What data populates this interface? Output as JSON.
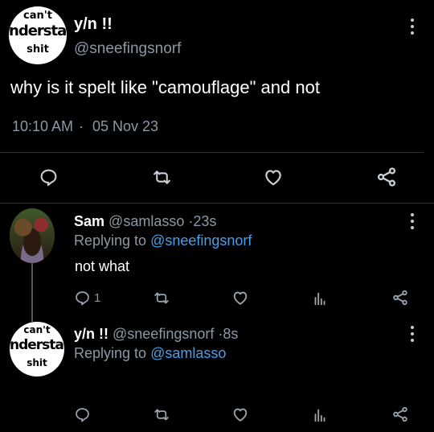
{
  "main_tweet": {
    "display_name": "y/n !!",
    "handle": "@sneefingsnorf",
    "text": "why is it spelt like \"camouflage\" and not",
    "time": "10:10 AM",
    "separator": "·",
    "date": "05 Nov 23",
    "avatar_logo": {
      "top": "can't",
      "middle": "nderstan",
      "bottom": "shit"
    }
  },
  "replies": [
    {
      "display_name": "Sam",
      "handle": "@samlasso",
      "time_sep": "·",
      "time": "23s",
      "replying_prefix": "Replying to",
      "replying_handle": "@sneefingsnorf",
      "text": "not what",
      "reply_count": "1"
    },
    {
      "display_name": "y/n !!",
      "handle": "@sneefingsnorf",
      "time_sep": "·",
      "time": "8s",
      "replying_prefix": "Replying to",
      "replying_handle": "@samlasso",
      "avatar_logo": {
        "top": "can't",
        "middle": "nderstan",
        "bottom": "shit"
      }
    }
  ],
  "icons": [
    "reply-icon",
    "retweet-icon",
    "like-icon",
    "share-icon",
    "analytics-icon",
    "more-icon"
  ],
  "colors": {
    "background": "#000000",
    "link": "#4a9ee8",
    "muted": "#8b98a5",
    "divider": "#2f3336"
  }
}
